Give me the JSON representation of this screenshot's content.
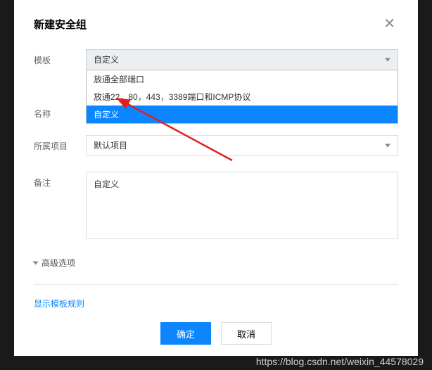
{
  "modal": {
    "title": "新建安全组",
    "form": {
      "template": {
        "label": "模板",
        "selected": "自定义",
        "options": [
          "放通全部端口",
          "放通22，80，443，3389端口和ICMP协议",
          "自定义"
        ]
      },
      "name": {
        "label": "名称"
      },
      "project": {
        "label": "所属项目",
        "selected": "默认项目"
      },
      "remark": {
        "label": "备注",
        "value": "自定义"
      }
    },
    "advanced": "高级选项",
    "showRules": "显示模板规则",
    "buttons": {
      "ok": "确定",
      "cancel": "取消"
    }
  },
  "watermark": "https://blog.csdn.net/weixin_44578029"
}
